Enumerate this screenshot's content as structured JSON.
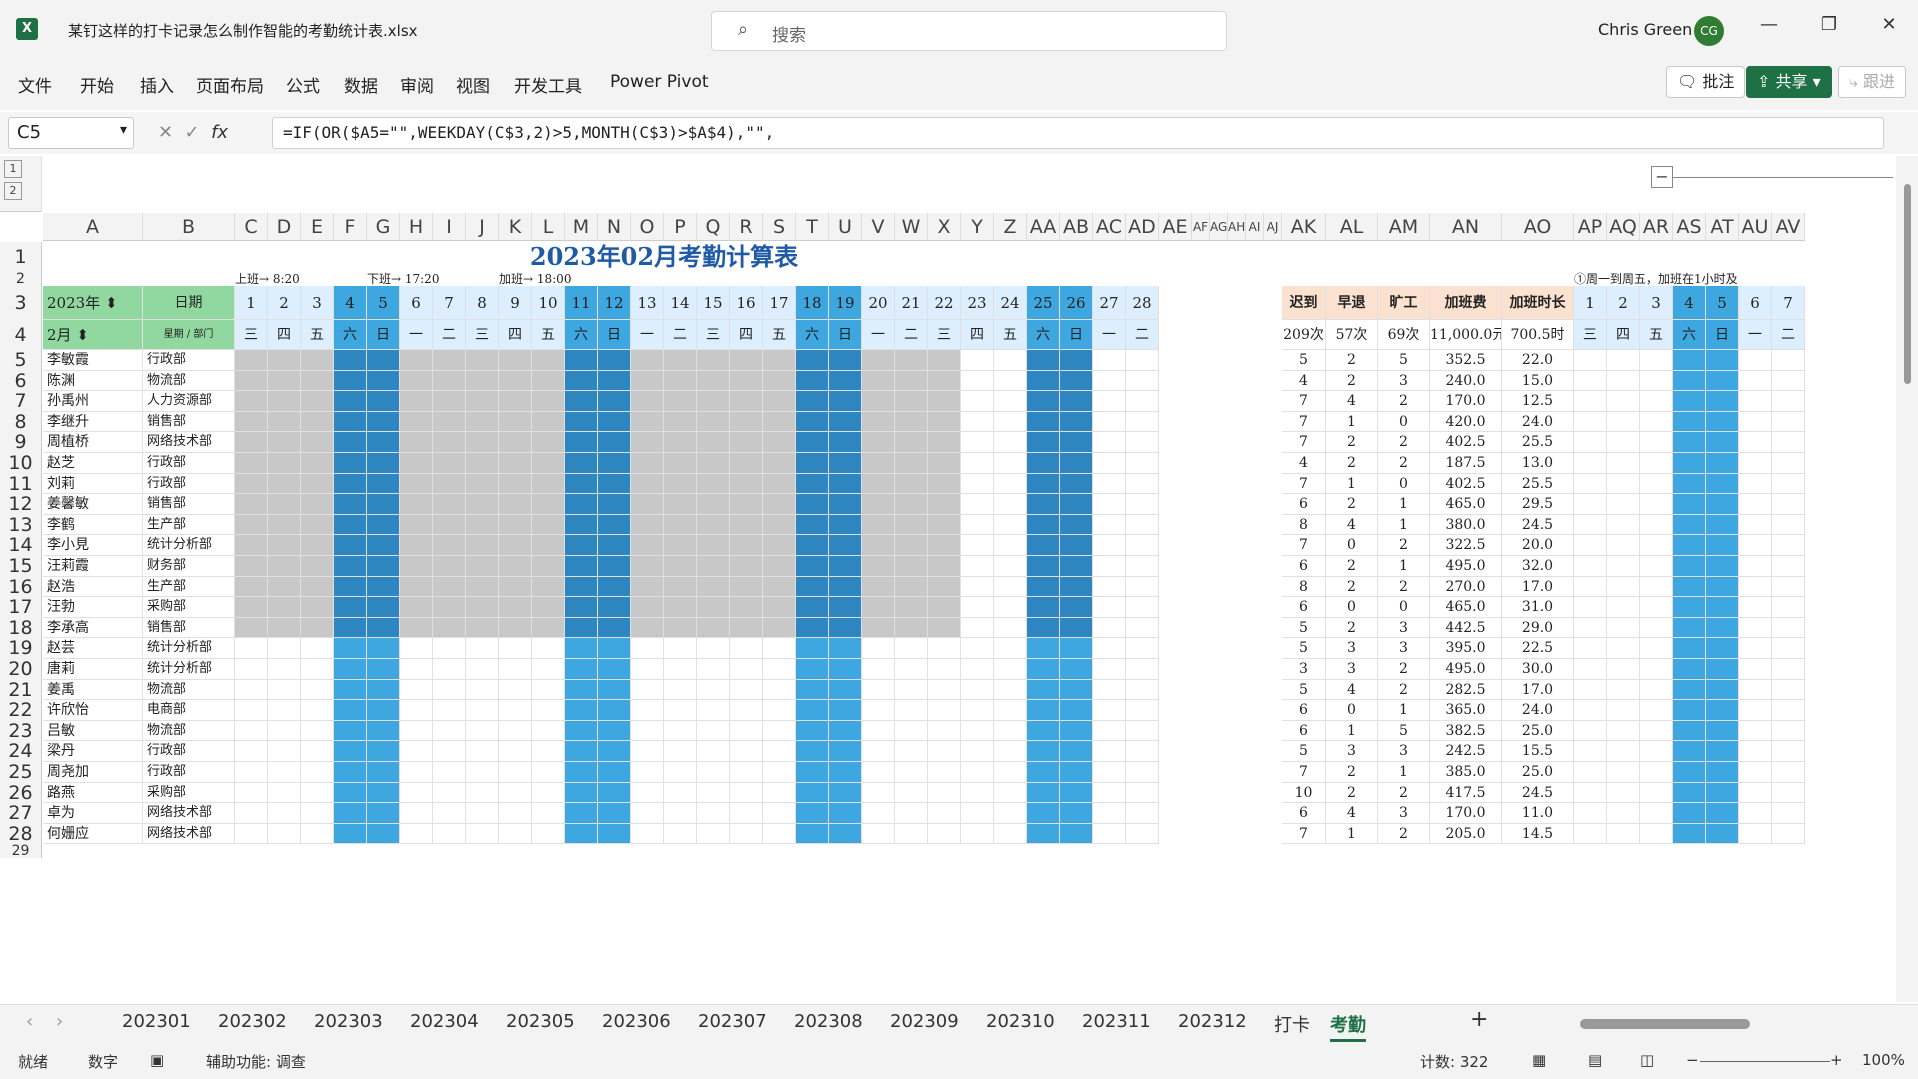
{
  "app": {
    "title": "某钉这样的打卡记录怎么制作智能的考勤统计表.xlsx",
    "search_placeholder": "搜索",
    "user": "Chris Green",
    "avatar": "CG"
  },
  "menu": [
    "文件",
    "开始",
    "插入",
    "页面布局",
    "公式",
    "数据",
    "审阅",
    "视图",
    "开发工具",
    "Power Pivot"
  ],
  "ribbon_right": {
    "comment": "批注",
    "share": "共享",
    "track": "跟进"
  },
  "formula": {
    "namebox": "C5",
    "fx": "fx",
    "text": "=IF(OR($A5=\"\",WEEKDAY(C$3,2)>5,MONTH(C$3)>$A$4),\"\","
  },
  "sheet": {
    "title": "2023年02月考勤计算表",
    "shift_label1": "上班→ 8:20",
    "shift_label2": "下班→ 17:20",
    "shift_label3": "加班→ 18:00",
    "note": "①周一到周五，加班在1小时及",
    "year_sel": "2023年",
    "month_sel": "2月",
    "date_label": "日期",
    "weekday_label": "星期",
    "dept_label": "部门",
    "col_letters": [
      "A",
      "B",
      "C",
      "D",
      "E",
      "F",
      "G",
      "H",
      "I",
      "J",
      "K",
      "L",
      "M",
      "N",
      "O",
      "P",
      "Q",
      "R",
      "S",
      "T",
      "U",
      "V",
      "W",
      "X",
      "Y",
      "Z",
      "AA",
      "AB",
      "AC",
      "AD",
      "AE",
      "AF",
      "AG",
      "AH",
      "AI",
      "AJ",
      "AK",
      "AL",
      "AM",
      "AN",
      "AO",
      "AP",
      "AQ",
      "AR",
      "AS",
      "AT",
      "AU",
      "AV"
    ],
    "days": [
      "1",
      "2",
      "3",
      "4",
      "5",
      "6",
      "7",
      "8",
      "9",
      "10",
      "11",
      "12",
      "13",
      "14",
      "15",
      "16",
      "17",
      "18",
      "19",
      "20",
      "21",
      "22",
      "23",
      "24",
      "25",
      "26",
      "27",
      "28"
    ],
    "weekdays": [
      "三",
      "四",
      "五",
      "六",
      "日",
      "一",
      "二",
      "三",
      "四",
      "五",
      "六",
      "日",
      "一",
      "二",
      "三",
      "四",
      "五",
      "六",
      "日",
      "一",
      "二",
      "三",
      "四",
      "五",
      "六",
      "日",
      "一",
      "二"
    ],
    "summary_headers": [
      "迟到",
      "早退",
      "旷工",
      "加班费",
      "加班时长"
    ],
    "summary_totals": [
      "209次",
      "57次",
      "69次",
      "11,000.0元",
      "700.5时"
    ],
    "right_days": [
      "1",
      "2",
      "3",
      "4",
      "5",
      "6",
      "7"
    ],
    "right_weekdays": [
      "三",
      "四",
      "五",
      "六",
      "日",
      "一",
      "二"
    ],
    "rows": [
      {
        "n": "5",
        "name": "李敏霞",
        "dept": "行政部",
        "s": [
          "5",
          "2",
          "5",
          "352.5",
          "22.0"
        ]
      },
      {
        "n": "6",
        "name": "陈渊",
        "dept": "物流部",
        "s": [
          "4",
          "2",
          "3",
          "240.0",
          "15.0"
        ]
      },
      {
        "n": "7",
        "name": "孙禹州",
        "dept": "人力资源部",
        "s": [
          "7",
          "4",
          "2",
          "170.0",
          "12.5"
        ]
      },
      {
        "n": "8",
        "name": "李继升",
        "dept": "销售部",
        "s": [
          "7",
          "1",
          "0",
          "420.0",
          "24.0"
        ]
      },
      {
        "n": "9",
        "name": "周植桥",
        "dept": "网络技术部",
        "s": [
          "7",
          "2",
          "2",
          "402.5",
          "25.5"
        ]
      },
      {
        "n": "10",
        "name": "赵芝",
        "dept": "行政部",
        "s": [
          "4",
          "2",
          "2",
          "187.5",
          "13.0"
        ]
      },
      {
        "n": "11",
        "name": "刘莉",
        "dept": "行政部",
        "s": [
          "7",
          "1",
          "0",
          "402.5",
          "25.5"
        ]
      },
      {
        "n": "12",
        "name": "姜馨敏",
        "dept": "销售部",
        "s": [
          "6",
          "2",
          "1",
          "465.0",
          "29.5"
        ]
      },
      {
        "n": "13",
        "name": "李鹤",
        "dept": "生产部",
        "s": [
          "8",
          "4",
          "1",
          "380.0",
          "24.5"
        ]
      },
      {
        "n": "14",
        "name": "李小見",
        "dept": "统计分析部",
        "s": [
          "7",
          "0",
          "2",
          "322.5",
          "20.0"
        ]
      },
      {
        "n": "15",
        "name": "汪莉霞",
        "dept": "财务部",
        "s": [
          "6",
          "2",
          "1",
          "495.0",
          "32.0"
        ]
      },
      {
        "n": "16",
        "name": "赵浩",
        "dept": "生产部",
        "s": [
          "8",
          "2",
          "2",
          "270.0",
          "17.0"
        ]
      },
      {
        "n": "17",
        "name": "汪勃",
        "dept": "采购部",
        "s": [
          "6",
          "0",
          "0",
          "465.0",
          "31.0"
        ]
      },
      {
        "n": "18",
        "name": "李承高",
        "dept": "销售部",
        "s": [
          "5",
          "2",
          "3",
          "442.5",
          "29.0"
        ]
      },
      {
        "n": "19",
        "name": "赵芸",
        "dept": "统计分析部",
        "s": [
          "5",
          "3",
          "3",
          "395.0",
          "22.5"
        ]
      },
      {
        "n": "20",
        "name": "唐莉",
        "dept": "统计分析部",
        "s": [
          "3",
          "3",
          "2",
          "495.0",
          "30.0"
        ]
      },
      {
        "n": "21",
        "name": "姜禹",
        "dept": "物流部",
        "s": [
          "5",
          "4",
          "2",
          "282.5",
          "17.0"
        ]
      },
      {
        "n": "22",
        "name": "许欣怡",
        "dept": "电商部",
        "s": [
          "6",
          "0",
          "1",
          "365.0",
          "24.0"
        ]
      },
      {
        "n": "23",
        "name": "吕敏",
        "dept": "物流部",
        "s": [
          "6",
          "1",
          "5",
          "382.5",
          "25.0"
        ]
      },
      {
        "n": "24",
        "name": "梁丹",
        "dept": "行政部",
        "s": [
          "5",
          "3",
          "3",
          "242.5",
          "15.5"
        ]
      },
      {
        "n": "25",
        "name": "周尧加",
        "dept": "行政部",
        "s": [
          "7",
          "2",
          "1",
          "385.0",
          "25.0"
        ]
      },
      {
        "n": "26",
        "name": "路燕",
        "dept": "采购部",
        "s": [
          "10",
          "2",
          "2",
          "417.5",
          "24.5"
        ]
      },
      {
        "n": "27",
        "name": "卓为",
        "dept": "网络技术部",
        "s": [
          "6",
          "4",
          "3",
          "170.0",
          "11.0"
        ]
      },
      {
        "n": "28",
        "name": "何姗应",
        "dept": "网络技术部",
        "s": [
          "7",
          "1",
          "2",
          "205.0",
          "14.5"
        ]
      }
    ]
  },
  "tabs": [
    "202301",
    "202302",
    "202303",
    "202304",
    "202305",
    "202306",
    "202307",
    "202308",
    "202309",
    "202310",
    "202311",
    "202312",
    "打卡",
    "考勤"
  ],
  "active_tab": "考勤",
  "status": {
    "ready": "就绪",
    "mode": "数字",
    "accessibility": "辅助功能: 调查",
    "count": "计数: 322",
    "zoom": "100%"
  },
  "colors": {
    "weekend": "#3ea7e0",
    "weekend_dark": "#2e86c1",
    "header_blue": "#ddefff",
    "green": "#90d8a0",
    "peach": "#fbe2d0"
  }
}
